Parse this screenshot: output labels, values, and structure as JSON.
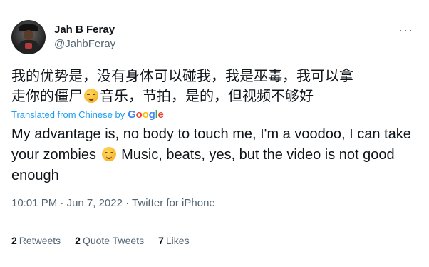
{
  "author": {
    "display_name": "Jah B Feray",
    "handle": "@JahbFeray"
  },
  "more_icon": "more-horizontal-icon",
  "tweet": {
    "original_line1": "我的优势是，没有身体可以碰我，我是巫毒，我可以拿",
    "original_line2_part1": "走你的僵尸",
    "original_line2_part2": "音乐，节拍，是的，但视频不够好",
    "translated_label": "Translated from Chinese by",
    "google_letters": [
      "G",
      "o",
      "o",
      "g",
      "l",
      "e"
    ],
    "translation_part1": "My advantage is, no body to touch me, I'm a voodoo, I can take your zombies",
    "translation_part2": "Music, beats, yes, but the video is not good enough",
    "emoji": "smirking-face-icon"
  },
  "meta": {
    "time": "10:01 PM",
    "sep1": "·",
    "date": "Jun 7, 2022",
    "sep2": "·",
    "source": "Twitter for iPhone"
  },
  "stats": [
    {
      "count": "2",
      "label": "Retweets"
    },
    {
      "count": "2",
      "label": "Quote Tweets"
    },
    {
      "count": "7",
      "label": "Likes"
    }
  ],
  "colors": {
    "link": "#1d9bf0",
    "secondary_text": "#536471",
    "primary_text": "#0f1419"
  }
}
